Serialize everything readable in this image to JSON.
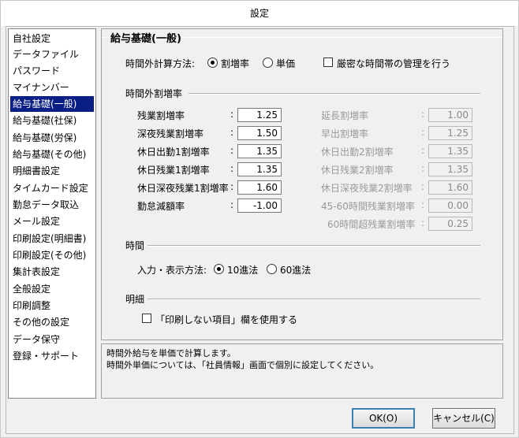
{
  "window": {
    "title": "設定"
  },
  "sidebar": {
    "items": [
      {
        "label": "自社設定"
      },
      {
        "label": "データファイル"
      },
      {
        "label": "パスワード"
      },
      {
        "label": "マイナンバー"
      },
      {
        "label": "給与基礎(一般)"
      },
      {
        "label": "給与基礎(社保)"
      },
      {
        "label": "給与基礎(労保)"
      },
      {
        "label": "給与基礎(その他)"
      },
      {
        "label": "明細書設定"
      },
      {
        "label": "タイムカード設定"
      },
      {
        "label": "勤怠データ取込"
      },
      {
        "label": "メール設定"
      },
      {
        "label": "印刷設定(明細書)"
      },
      {
        "label": "印刷設定(その他)"
      },
      {
        "label": "集計表設定"
      },
      {
        "label": "全般設定"
      },
      {
        "label": "印刷調整"
      },
      {
        "label": "その他の設定"
      },
      {
        "label": "データ保守"
      },
      {
        "label": "登録・サポート"
      }
    ],
    "selected_index": 4
  },
  "main": {
    "title": "給与基礎(一般)",
    "calc_method": {
      "label": "時間外計算方法:",
      "option1": "割増率",
      "option2": "単価",
      "selected": "割増率",
      "strict_label": "厳密な時間帯の管理を行う",
      "strict_checked": false
    },
    "overtime": {
      "title": "時間外割増率",
      "colon": ":",
      "left": [
        {
          "label": "残業割増率",
          "value": "1.25"
        },
        {
          "label": "深夜残業割増率",
          "value": "1.50"
        },
        {
          "label": "休日出勤1割増率",
          "value": "1.35"
        },
        {
          "label": "休日残業1割増率",
          "value": "1.35"
        },
        {
          "label": "休日深夜残業1割増率",
          "value": "1.60"
        },
        {
          "label": "勤怠減額率",
          "value": "-1.00"
        }
      ],
      "right": [
        {
          "label": "延長割増率",
          "value": "1.00"
        },
        {
          "label": "早出割増率",
          "value": "1.25"
        },
        {
          "label": "休日出勤2割増率",
          "value": "1.35"
        },
        {
          "label": "休日残業2割増率",
          "value": "1.35"
        },
        {
          "label": "休日深夜残業2割増率",
          "value": "1.60"
        },
        {
          "label": "45-60時間残業割増率",
          "value": "0.00"
        },
        {
          "label": "60時間超残業割増率",
          "value": "0.25"
        }
      ]
    },
    "time": {
      "title": "時間",
      "label": "入力・表示方法:",
      "option1": "10進法",
      "option2": "60進法",
      "selected": "10進法"
    },
    "meisai": {
      "title": "明細",
      "checkbox_label": "「印刷しない項目」欄を使用する",
      "checked": false
    }
  },
  "description": {
    "line1": "時間外給与を単価で計算します。",
    "line2": "時間外単価については、「社員情報」画面で個別に設定してください。"
  },
  "buttons": {
    "ok": "OK(O)",
    "cancel": "キャンセル(C)"
  }
}
